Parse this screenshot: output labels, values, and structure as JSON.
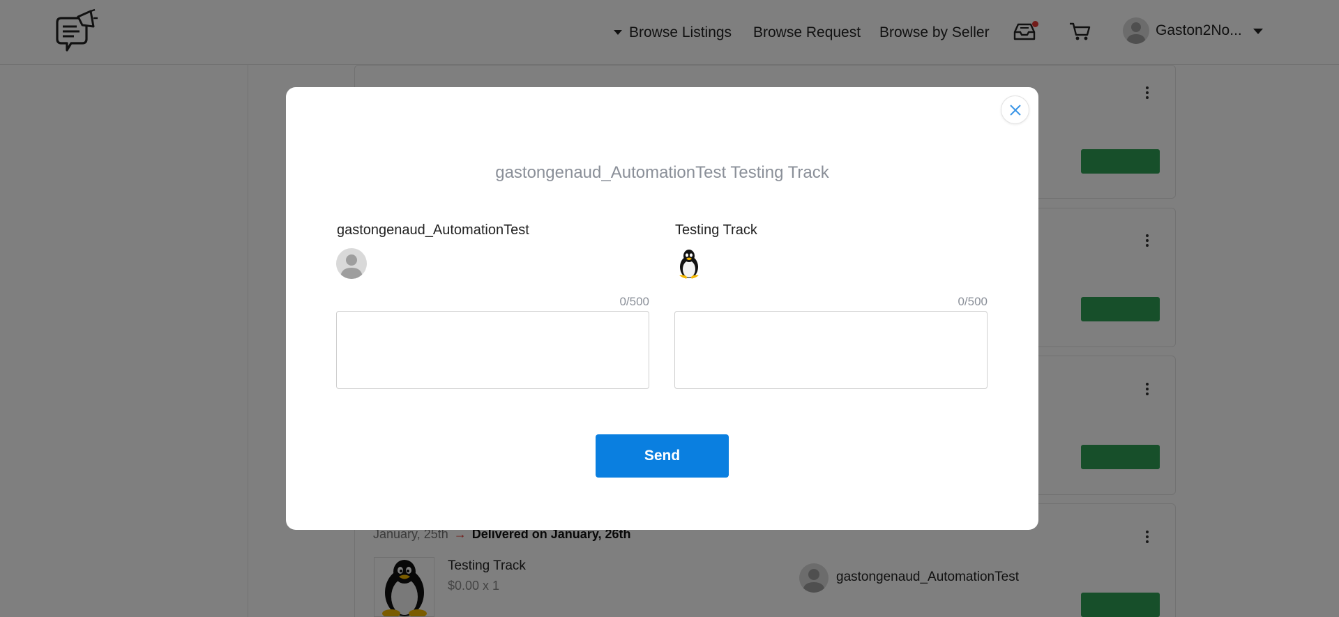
{
  "header": {
    "logo_icon": "chat-megaphone-logo-icon",
    "nav": {
      "browse_listings": "Browse Listings",
      "browse_request": "Browse Request",
      "browse_by_seller": "Browse by Seller"
    },
    "inbox_icon": "inbox-tray-icon",
    "inbox_has_notification": true,
    "cart_icon": "shopping-cart-icon",
    "user_name": "Gaston2No..."
  },
  "background_order": {
    "date": "January, 25th",
    "delivered": "Delivered on January, 26th",
    "item_title": "Testing Track",
    "price": "$0.00 x 1",
    "seller": "gastongenaud_AutomationTest"
  },
  "modal": {
    "title": "gastongenaud_AutomationTest Testing Track",
    "buyer_name": "gastongenaud_AutomationTest",
    "buyer_counter": "0/500",
    "buyer_text": "",
    "listing_name": "Testing Track",
    "listing_counter": "0/500",
    "listing_text": "",
    "send_label": "Send"
  },
  "colors": {
    "primary": "#0a7fe0",
    "success": "#2e9e55",
    "notification": "#e53935",
    "muted_text": "#8a8f98"
  }
}
